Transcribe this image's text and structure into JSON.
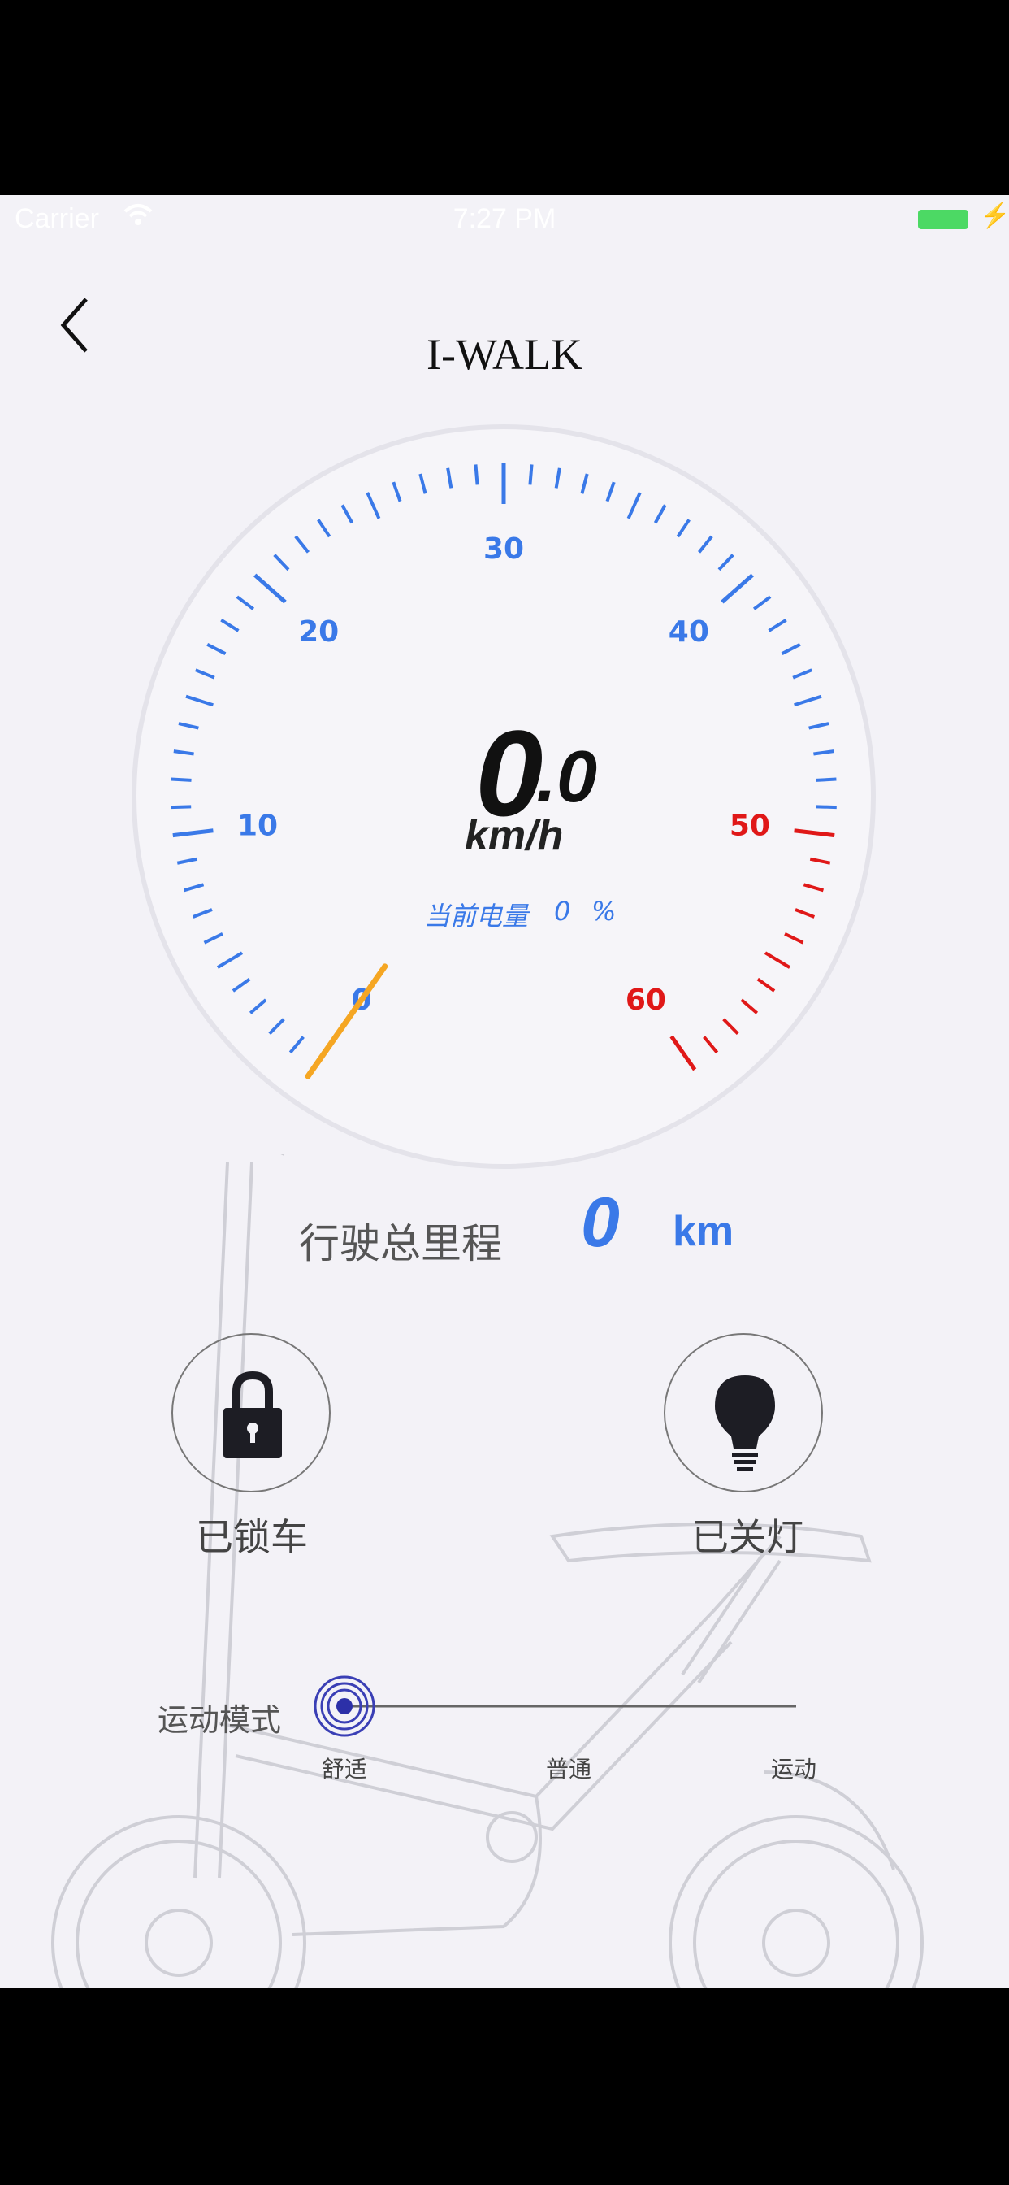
{
  "status_bar": {
    "carrier": "Carrier",
    "time": "7:27 PM"
  },
  "title": "I-WALK",
  "speedometer": {
    "speed_int": "0",
    "speed_dec": ".0",
    "unit": "km/h",
    "battery_label": "当前电量",
    "battery_value": "0",
    "battery_unit": "%",
    "scale_labels": [
      "0",
      "10",
      "20",
      "30",
      "40",
      "50",
      "60"
    ],
    "scale_color": "#3a79e8",
    "danger_color": "#e01818",
    "needle_color": "#f5a623"
  },
  "mileage": {
    "label": "行驶总里程",
    "value": "0",
    "unit": "km"
  },
  "controls": {
    "lock": {
      "label": "已锁车",
      "icon": "lock-icon"
    },
    "light": {
      "label": "已关灯",
      "icon": "bulb-icon"
    }
  },
  "mode": {
    "label": "运动模式",
    "options": [
      "舒适",
      "普通",
      "运动"
    ],
    "selected": "舒适"
  }
}
